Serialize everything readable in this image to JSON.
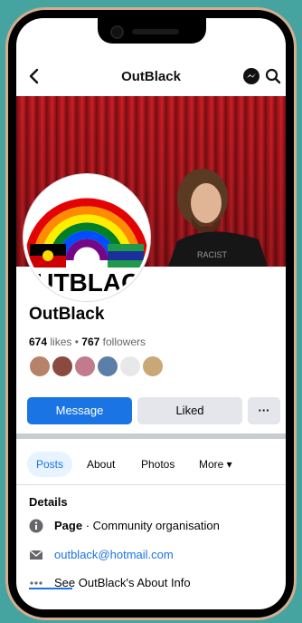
{
  "nav": {
    "title": "OutBlack",
    "back_icon": "back-arrow-icon",
    "messenger_icon": "messenger-icon",
    "search_icon": "search-icon"
  },
  "profile": {
    "name": "OutBlack",
    "likes_count": "674",
    "likes_label": "likes",
    "separator": "•",
    "followers_count": "767",
    "followers_label": "followers",
    "logo_text": "OUTBLACK"
  },
  "friends": [
    {
      "color": "#b6826a"
    },
    {
      "color": "#8a4a3f"
    },
    {
      "color": "#c27a8c"
    },
    {
      "color": "#5b7fa6"
    },
    {
      "color": "#e8e8e8"
    },
    {
      "color": "#c9a878"
    }
  ],
  "actions": {
    "message_label": "Message",
    "liked_label": "Liked",
    "more_label": "···"
  },
  "tabs": [
    {
      "label": "Posts",
      "active": true
    },
    {
      "label": "About"
    },
    {
      "label": "Photos"
    },
    {
      "label": "More ▾"
    }
  ],
  "details": {
    "title": "Details",
    "page_type_prefix": "Page",
    "page_type": " · Community organisation",
    "email": "outblack@hotmail.com",
    "see_about": "See OutBlack's About Info"
  },
  "colors": {
    "accent": "#1b74e4",
    "background": "#46a4a0",
    "frame": "#d4ad8f"
  }
}
